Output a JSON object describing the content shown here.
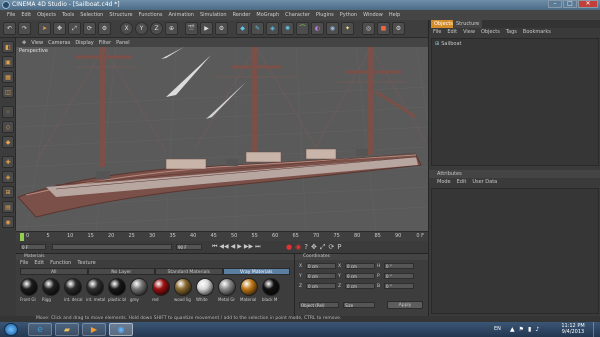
{
  "window": {
    "title": "CINEMA 4D Studio - [Sailboat.c4d *]"
  },
  "menubar": [
    "File",
    "Edit",
    "Objects",
    "Tools",
    "Selection",
    "Structure",
    "Functions",
    "Animation",
    "Simulation",
    "Render",
    "MoGraph",
    "Character",
    "Plugins",
    "Python",
    "Window",
    "Help"
  ],
  "toolbar": {
    "axis_x": "X",
    "axis_y": "Y",
    "axis_z": "Z"
  },
  "viewport": {
    "menu": [
      "View",
      "Cameras",
      "Display",
      "Filter",
      "Panel"
    ],
    "label": "Perspective"
  },
  "timeline": {
    "ticks": [
      "0",
      "5",
      "10",
      "15",
      "20",
      "25",
      "30",
      "35",
      "40",
      "45",
      "50",
      "55",
      "60",
      "65",
      "70",
      "75",
      "80",
      "85",
      "90"
    ],
    "current_frame": "0 F"
  },
  "transport": {
    "start": "0 F",
    "end": "90 F"
  },
  "materials": {
    "header": "Materials",
    "menu": [
      "File",
      "Edit",
      "Function",
      "Texture"
    ],
    "tabs": [
      "All",
      "No Layer",
      "Standard Materials",
      "Vray Materials"
    ],
    "active_tab": "Vray Materials",
    "items": [
      {
        "label": "Front Gl",
        "color": "#1c1c1c"
      },
      {
        "label": "Rigg",
        "color": "#222222"
      },
      {
        "label": "int. decal",
        "color": "#2a2a2a"
      },
      {
        "label": "int. metal",
        "color": "#303030"
      },
      {
        "label": "plastic bl",
        "color": "#181818"
      },
      {
        "label": "grey",
        "color": "#777777"
      },
      {
        "label": "red",
        "color": "#9b1010"
      },
      {
        "label": "wood lig",
        "color": "#8a6a30"
      },
      {
        "label": "White",
        "color": "#d8d8d8"
      },
      {
        "label": "Metal Gr",
        "color": "#8c8c8c"
      },
      {
        "label": "Material",
        "color": "#c07a18"
      },
      {
        "label": "black M",
        "color": "#111111"
      }
    ]
  },
  "coordinates": {
    "header": "Coordinates",
    "rows": [
      {
        "axis": "X",
        "pos": "0 cm",
        "axis2": "X",
        "size": "0 cm",
        "axis3": "H",
        "rot": "0 °"
      },
      {
        "axis": "Y",
        "pos": "0 cm",
        "axis2": "Y",
        "size": "0 cm",
        "axis3": "P",
        "rot": "0 °"
      },
      {
        "axis": "Z",
        "pos": "0 cm",
        "axis2": "Z",
        "size": "0 cm",
        "axis3": "B",
        "rot": "0 °"
      }
    ],
    "mode": "Object (Rel)",
    "size_mode": "Size",
    "apply": "Apply"
  },
  "objects": {
    "tabs": [
      "Objects",
      "Structure"
    ],
    "menu": [
      "File",
      "Edit",
      "View",
      "Objects",
      "Tags",
      "Bookmarks"
    ],
    "tree": [
      "Sailboat"
    ]
  },
  "attributes": {
    "header": "Attributes",
    "menu": [
      "Mode",
      "Edit",
      "User Data"
    ]
  },
  "status": {
    "text": "Move: Click and drag to move elements. Hold down SHIFT to quantize movement / add to the selection in point mode, CTRL to remove."
  },
  "taskbar": {
    "lang": "EN",
    "time": "11:12 PM",
    "date": "9/4/2013"
  },
  "colors": {
    "accent": "#e9a34b",
    "viewport_bg": "#5a5a5a",
    "hull": "#7a5048",
    "sail": "#dcdcdc"
  }
}
